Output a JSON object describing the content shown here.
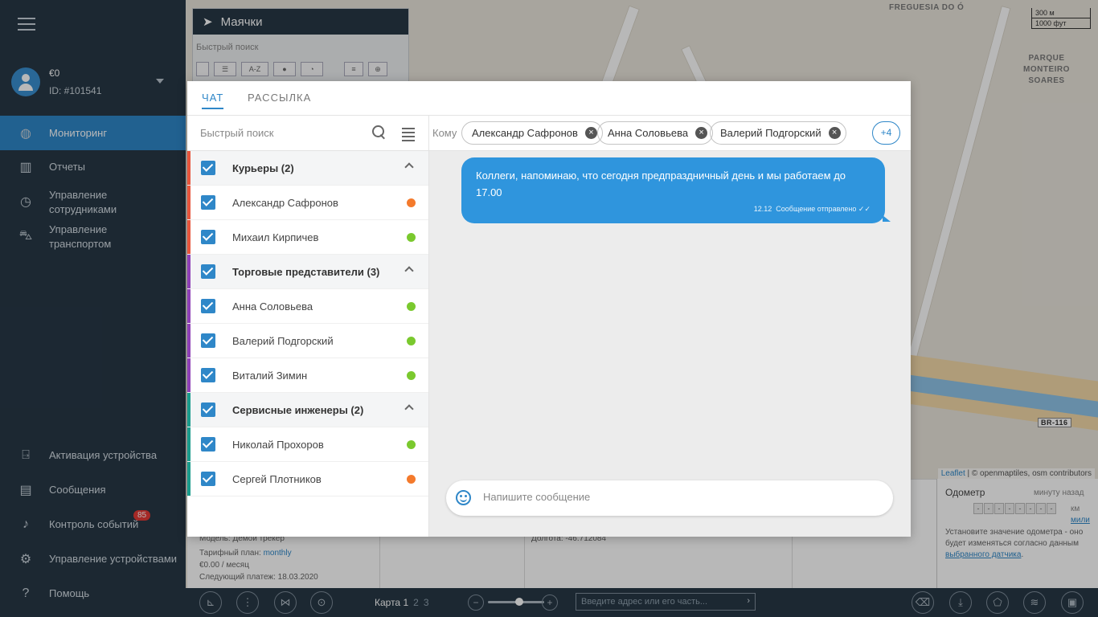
{
  "sidebar": {
    "user": {
      "balance": "€0",
      "id": "ID: #101541"
    },
    "nav": [
      {
        "label": "Мониторинг",
        "icon": "globe-icon"
      },
      {
        "label": "Отчеты",
        "icon": "bar-chart-icon"
      },
      {
        "label": "Управление сотрудниками",
        "icon": "location-pin-icon"
      },
      {
        "label": "Управление транспортом",
        "icon": "car-icon"
      }
    ],
    "bottom_nav": [
      {
        "label": "Активация устройства",
        "icon": "device-add-icon"
      },
      {
        "label": "Сообщения",
        "icon": "chat-icon"
      },
      {
        "label": "Контроль событий",
        "icon": "bell-icon",
        "badge": "85"
      },
      {
        "label": "Управление устройствами",
        "icon": "gear-icon"
      },
      {
        "label": "Помощь",
        "icon": "help-icon"
      }
    ]
  },
  "beacons_panel": {
    "title": "Маячки",
    "quick_search": "Быстрый поиск",
    "sort_label": "A-Z"
  },
  "map": {
    "labels": [
      "FREGUESIA DO Ó",
      "PARQUE MONTEIRO SOARES",
      "BR-116"
    ],
    "scale_top": "300 м",
    "scale_bottom": "1000 фут",
    "attribution_leaflet": "Leaflet",
    "attribution_rest": " | © openmaptiles, osm contributors"
  },
  "bottom_panel": {
    "model": "Модель: Демой трекер",
    "tariff_label": "Тарифный план:",
    "tariff_value": "monthly",
    "price": "€0.00 / месяц",
    "next_payment": "Следующий платеж: 18.03.2020",
    "longitude": "Долгота: -46.712084",
    "odometer_title": "Одометр",
    "odometer_sub": "минуту назад",
    "odometer_digits": [
      "-",
      "-",
      "-",
      "-",
      "-",
      "-",
      "-",
      "-"
    ],
    "unit_km": "км",
    "unit_mi": "мили",
    "odometer_note": "Установите значение одометра - оно будет изменяться согласно данным",
    "odometer_link": "выбранного датчика"
  },
  "toolbar": {
    "maps_label": "Карта 1",
    "map2": "2",
    "map3": "3",
    "address_placeholder": "Введите адрес или его часть..."
  },
  "modal": {
    "tabs": [
      "ЧАТ",
      "РАССЫЛКА"
    ],
    "search_placeholder": "Быстрый поиск",
    "to_label": "Кому",
    "recipients": [
      "Александр Сафронов",
      "Анна Соловьева",
      "Валерий Подгорский"
    ],
    "more_recipients": "+4",
    "groups": [
      {
        "name": "Курьеры (2)",
        "color": "#e8553c",
        "members": [
          {
            "name": "Александр Сафронов",
            "status": "#f47a2c"
          },
          {
            "name": "Михаил Кирпичев",
            "status": "#7ac92e"
          }
        ]
      },
      {
        "name": "Торговые представители (3)",
        "color": "#8e3fb6",
        "members": [
          {
            "name": "Анна Соловьева",
            "status": "#7ac92e"
          },
          {
            "name": "Валерий Подгорский",
            "status": "#7ac92e"
          },
          {
            "name": "Виталий Зимин",
            "status": "#7ac92e"
          }
        ]
      },
      {
        "name": "Сервисные инженеры (2)",
        "color": "#1a9c8c",
        "members": [
          {
            "name": "Николай Прохоров",
            "status": "#7ac92e"
          },
          {
            "name": "Сергей Плотников",
            "status": "#f47a2c"
          }
        ]
      }
    ],
    "message": {
      "text": "Коллеги, напоминаю, что сегодня предпраздничный день и мы работаем до 17.00",
      "time": "12.12",
      "status": "Сообщение отправлено"
    },
    "composer_placeholder": "Напишите сообщение"
  }
}
